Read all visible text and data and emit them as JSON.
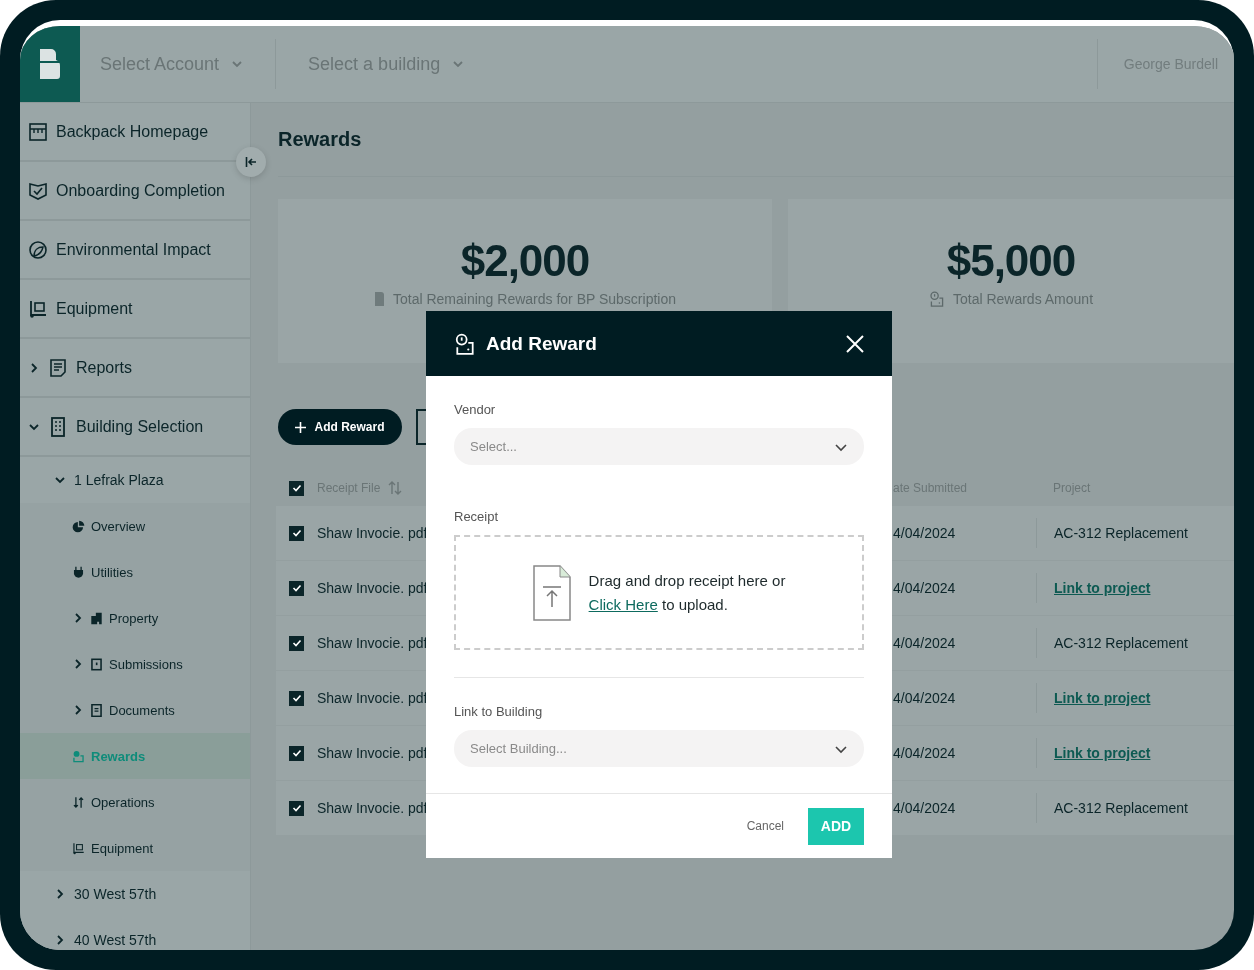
{
  "header": {
    "account_select": "Select Account",
    "building_select": "Select a building",
    "user_name": "George Burdell"
  },
  "sidebar": {
    "items": [
      {
        "label": "Backpack Homepage",
        "selected": false
      },
      {
        "label": "Onboarding Completion",
        "selected": false
      },
      {
        "label": "Environmental Impact",
        "selected": false
      },
      {
        "label": "Equipment",
        "selected": false
      },
      {
        "label": "Reports",
        "selected": false,
        "expanded": false
      },
      {
        "label": "Building Selection",
        "selected": false,
        "expanded": true,
        "children": [
          {
            "label": "1 Lefrak Plaza",
            "selected": false,
            "expanded": true,
            "children": [
              {
                "label": "Overview",
                "selected": false
              },
              {
                "label": "Utilities",
                "selected": false
              },
              {
                "label": "Property",
                "selected": false,
                "expanded": false
              },
              {
                "label": "Submissions",
                "selected": false,
                "expanded": false
              },
              {
                "label": "Documents",
                "selected": false,
                "expanded": false
              },
              {
                "label": "Rewards",
                "selected": true
              },
              {
                "label": "Operations",
                "selected": false
              },
              {
                "label": "Equipment",
                "selected": false
              }
            ]
          },
          {
            "label": "30 West 57th",
            "selected": false,
            "expanded": false
          },
          {
            "label": "40 West 57th",
            "selected": false,
            "expanded": false
          }
        ]
      }
    ]
  },
  "page": {
    "title": "Rewards"
  },
  "cards": [
    {
      "amount": "$2,000",
      "caption": "Total Remaining Rewards for BP Subscription"
    },
    {
      "amount": "$5,000",
      "caption": "Total Rewards Amount"
    }
  ],
  "toolbar": {
    "add_button": "Add Reward"
  },
  "table": {
    "all_checked": true,
    "columns": [
      "Receipt File",
      "ate Submitted",
      "Project"
    ],
    "rows": [
      {
        "checked": true,
        "receipt_file": "Shaw Invocie. pdf",
        "date_submitted": "4/04/2024",
        "project": {
          "kind": "text",
          "label": "AC-312 Replacement"
        }
      },
      {
        "checked": true,
        "receipt_file": "Shaw Invocie. pdf",
        "date_submitted": "4/04/2024",
        "project": {
          "kind": "link",
          "label": "Link to project"
        }
      },
      {
        "checked": true,
        "receipt_file": "Shaw Invocie. pdf",
        "date_submitted": "4/04/2024",
        "project": {
          "kind": "text",
          "label": "AC-312 Replacement"
        }
      },
      {
        "checked": true,
        "receipt_file": "Shaw Invocie. pdf",
        "date_submitted": "4/04/2024",
        "project": {
          "kind": "link",
          "label": "Link to project"
        }
      },
      {
        "checked": true,
        "receipt_file": "Shaw Invocie. pdf",
        "date_submitted": "4/04/2024",
        "project": {
          "kind": "link",
          "label": "Link to project"
        }
      },
      {
        "checked": true,
        "receipt_file": "Shaw Invocie. pdf",
        "date_submitted": "4/04/2024",
        "project": {
          "kind": "text",
          "label": "AC-312 Replacement"
        }
      }
    ]
  },
  "modal": {
    "title": "Add Reward",
    "vendor": {
      "label": "Vendor",
      "placeholder": "Select..."
    },
    "receipt": {
      "label": "Receipt",
      "text_before": "Drag and drop receipt here or",
      "link": "Click Here",
      "text_after": "to upload."
    },
    "building": {
      "label": "Link to Building",
      "placeholder": "Select Building..."
    },
    "cancel_button": "Cancel",
    "add_button": "ADD"
  }
}
